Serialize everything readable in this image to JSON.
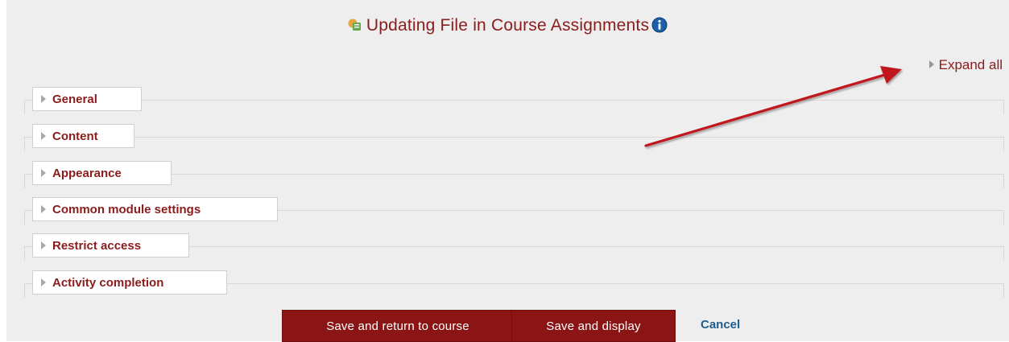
{
  "page": {
    "title": "Updating File in Course Assignments",
    "expand_all_label": "Expand all"
  },
  "sections": [
    {
      "label": "General"
    },
    {
      "label": "Content"
    },
    {
      "label": "Appearance"
    },
    {
      "label": "Common module settings"
    },
    {
      "label": "Restrict access"
    },
    {
      "label": "Activity completion"
    }
  ],
  "actions": {
    "save_return_label": "Save and return to course",
    "save_display_label": "Save and display",
    "cancel_label": "Cancel"
  },
  "colors": {
    "accent": "#8b1515",
    "heading_text": "#8a1c1c",
    "link": "#1f5c8a",
    "background": "#eeeeee",
    "annotation_arrow": "#c0181c"
  },
  "icons": {
    "title_icon": "file-module-icon",
    "info_icon": "info-icon",
    "collapse_icon": "triangle-right-icon"
  }
}
